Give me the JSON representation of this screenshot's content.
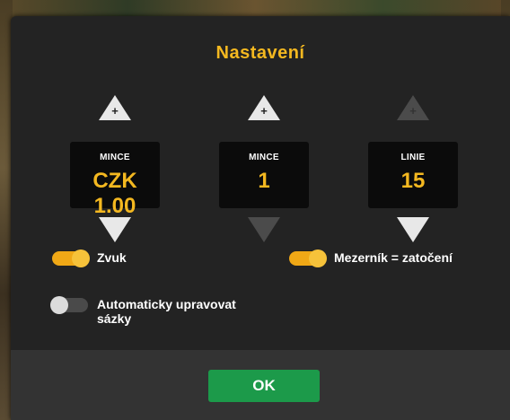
{
  "dialog": {
    "title": "Nastavení"
  },
  "spinners": [
    {
      "label": "MINCE",
      "value": "CZK 1.00",
      "up_enabled": true,
      "down_enabled": true
    },
    {
      "label": "MINCE",
      "value": "1",
      "up_enabled": true,
      "down_enabled": false
    },
    {
      "label": "LINIE",
      "value": "15",
      "up_enabled": false,
      "down_enabled": true
    }
  ],
  "toggles": {
    "sound": {
      "label": "Zvuk",
      "on": true
    },
    "spacebar_spin": {
      "label": "Mezerník = zatočení",
      "on": true
    },
    "auto_adjust_bets": {
      "label_line1": "Automaticky upravovat",
      "label_line2": "sázky",
      "on": false
    }
  },
  "footer": {
    "ok_label": "OK"
  },
  "colors": {
    "accent": "#f4b820",
    "panel": "#232323",
    "footer": "#333333",
    "ok_button": "#1c9a4a",
    "toggle_on": "#f0a816",
    "toggle_off": "#4a4a4a"
  },
  "icons": {
    "increase": "plus-triangle-up-icon",
    "decrease": "triangle-down-icon"
  }
}
